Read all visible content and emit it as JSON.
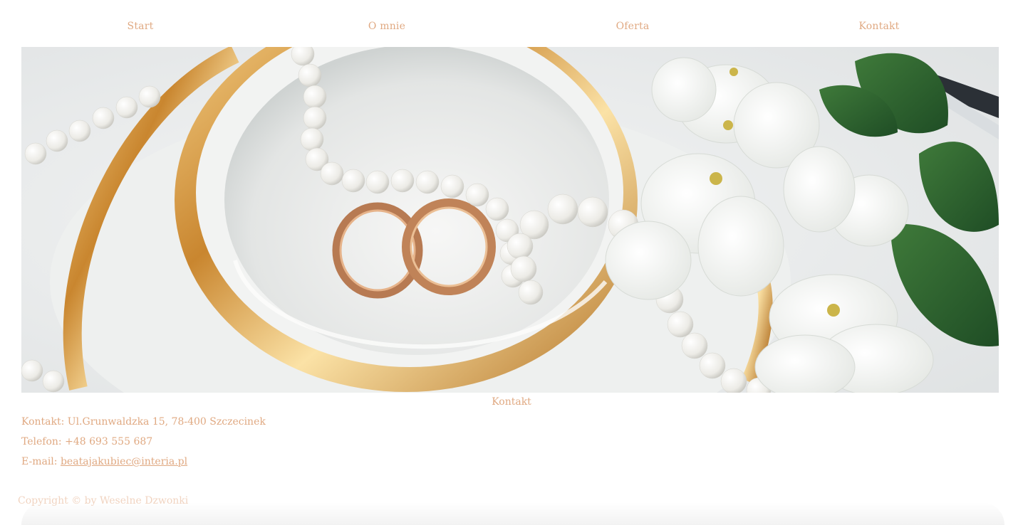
{
  "nav": {
    "items": [
      "Start",
      "O mnie",
      "Oferta",
      "Kontakt"
    ]
  },
  "hero": {
    "description_icon": "wedding-rings-photo"
  },
  "contact": {
    "title": "Kontakt",
    "address_label": "Kontakt:",
    "address": "Ul.Grunwaldzka 15, 78-400 Szczecinek",
    "phone_label": "Telefon:",
    "phone": "+48 693 555 687",
    "email_label": "E-mail:",
    "email": "beatajakubiec@interia.pl"
  },
  "footer": {
    "copyright": "Copyright © by Weselne Dzwonki"
  },
  "colors": {
    "accent": "#e0a982",
    "copyright": "#f1d4c1"
  }
}
